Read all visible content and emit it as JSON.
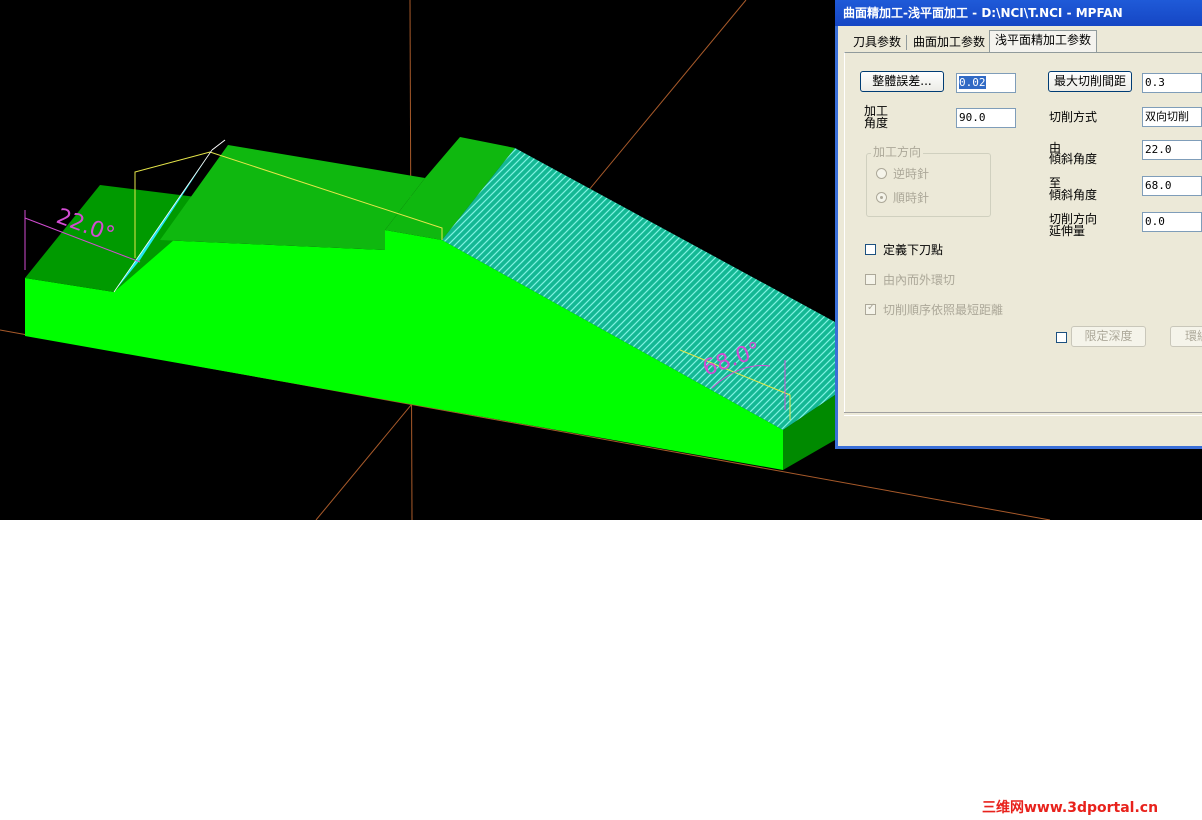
{
  "dialog": {
    "title": "曲面精加工-浅平面加工 - D:\\NCI\\T.NCI - MPFAN",
    "tabs": [
      "刀具参数",
      "曲面加工参数",
      "浅平面精加工参数"
    ],
    "active_tab": "浅平面精加工参数",
    "tolerance_button": "整體誤差...",
    "tolerance_value": "0.02",
    "angle_label_line1": "加工",
    "angle_label_line2": "角度",
    "angle_value": "90.0",
    "direction_group": "加工方向",
    "ccw_label": "逆時針",
    "cw_label": "順時針",
    "define_plunge_label": "定義下刀點",
    "inside_out_label": "由內而外環切",
    "order_shortest_label": "切削順序依照最短距離",
    "max_stepover_button": "最大切削間距",
    "max_stepover_value": "0.3",
    "cut_method_label": "切削方式",
    "cut_method_value": "双向切削",
    "from_label_line1": "由",
    "from_label_line2": "傾斜角度",
    "from_value": "22.0",
    "to_label_line1": "至",
    "to_label_line2": "傾斜角度",
    "to_value": "68.0",
    "extension_label_line1": "切削方向",
    "extension_label_line2": "延伸量",
    "extension_value": "0.0",
    "limit_depth_button": "限定深度",
    "partial_button": "環繞"
  },
  "viewport": {
    "angle_22": "22.0°",
    "angle_68": "68.0°",
    "colors": {
      "background": "#000000",
      "solid_top": "#0fc40f",
      "solid_front": "#00ff00",
      "solid_side": "#008a00",
      "flat_surface": "#00e8e8",
      "hatch": "#2fd6b6",
      "axis": "#a85a2a",
      "dimension": "#d24cd2"
    }
  },
  "watermark": "三维网www.3dportal.cn"
}
